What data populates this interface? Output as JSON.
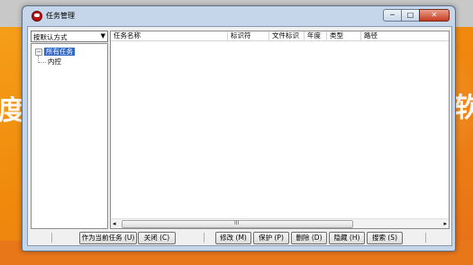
{
  "window": {
    "title": "任务管理",
    "buttons": {
      "minimize": "─",
      "maximize": "□",
      "close": "✕"
    }
  },
  "left_panel": {
    "sort_combo": {
      "value": "按默认方式"
    },
    "tree": {
      "expand_glyph": "−",
      "root": "所有任务",
      "children": [
        "内控"
      ]
    }
  },
  "list": {
    "columns": [
      "任务名称",
      "标识符",
      "文件标识",
      "年度",
      "类型",
      "路径"
    ],
    "rows": [],
    "scroll": {
      "left": "◂",
      "right": "▸",
      "grip": "III"
    }
  },
  "buttons": {
    "set_current": "作为当前任务 (U)",
    "close": "关闭 (C)",
    "modify": "修改 (M)",
    "protect": "保护 (P)",
    "delete": "删除 (D)",
    "hide": "隐藏 (H)",
    "search": "搜索 (S)"
  },
  "background": {
    "chars": [
      "度",
      "软"
    ],
    "colors": {
      "accent": "#f08a0c",
      "selection": "#3168c6"
    }
  }
}
